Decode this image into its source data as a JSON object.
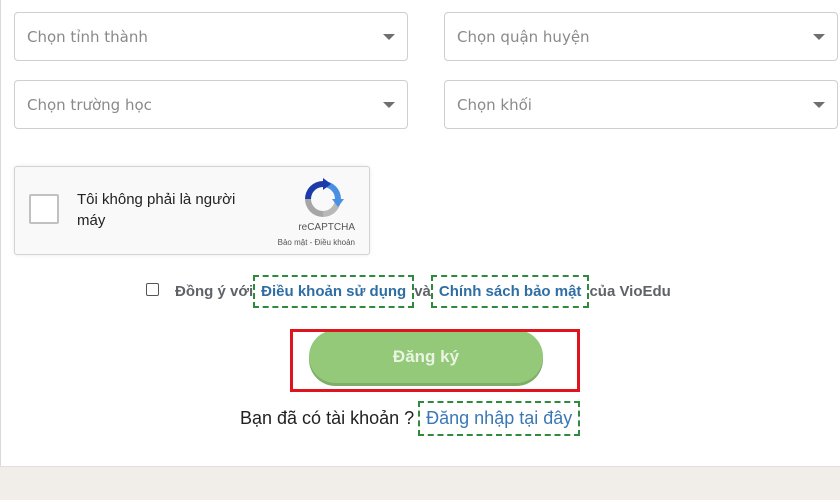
{
  "selects": {
    "province": {
      "placeholder": "Chọn tỉnh thành"
    },
    "district": {
      "placeholder": "Chọn quận huyện"
    },
    "school": {
      "placeholder": "Chọn trường học"
    },
    "grade": {
      "placeholder": "Chọn khối"
    }
  },
  "captcha": {
    "label": "Tôi không phải là người máy",
    "brand": "reCAPTCHA",
    "links": "Bảo mật - Điều khoản"
  },
  "agree": {
    "prefix": "Đồng ý với",
    "terms_link": "Điều khoản sử dụng",
    "middle": "và",
    "privacy_link": "Chính sách bảo mật",
    "suffix": "của VioEdu"
  },
  "submit": {
    "label": "Đăng ký"
  },
  "login": {
    "prompt": "Bạn đã có tài khoản ?",
    "link": "Đăng nhập tại đây"
  },
  "colors": {
    "submit_bg": "#94c97a",
    "link": "#3a78b5",
    "highlight": "#e0141f",
    "dashed_outline": "#2e8b3e"
  }
}
